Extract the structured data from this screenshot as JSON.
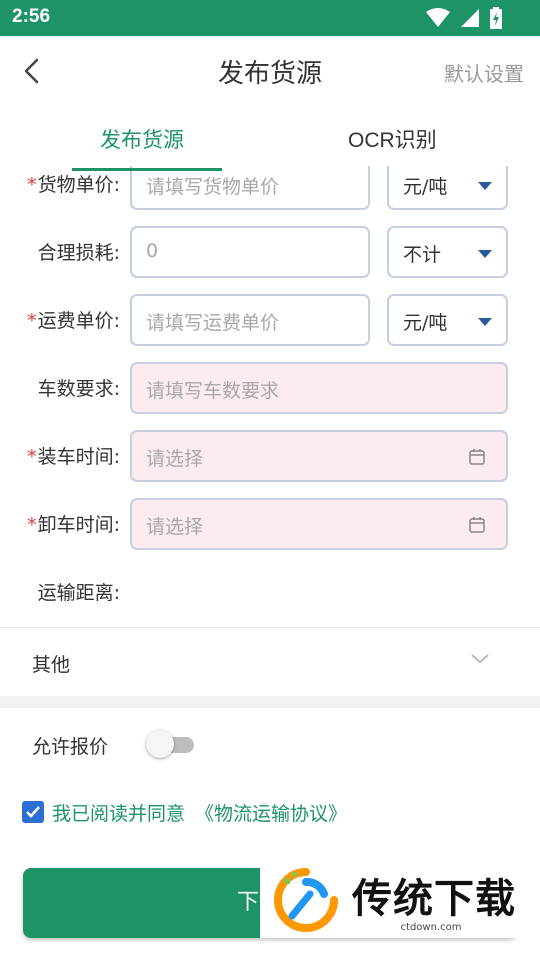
{
  "status_bar": {
    "time": "2:56"
  },
  "app_bar": {
    "title": "发布货源",
    "action": "默认设置"
  },
  "tabs": [
    {
      "label": "发布货源"
    },
    {
      "label": "OCR识别"
    }
  ],
  "form": {
    "unit_price": {
      "required_mark": "*",
      "label": "货物单价:",
      "placeholder": "请填写货物单价",
      "unit": "元/吨"
    },
    "loss": {
      "label": "合理损耗:",
      "value": "0",
      "option": "不计"
    },
    "freight": {
      "required_mark": "*",
      "label": "运费单价:",
      "placeholder": "请填写运费单价",
      "unit": "元/吨"
    },
    "trucks": {
      "label": "车数要求:",
      "placeholder": "请填写车数要求"
    },
    "load_time": {
      "required_mark": "*",
      "label": "装车时间:",
      "placeholder": "请选择"
    },
    "unload_time": {
      "required_mark": "*",
      "label": "卸车时间:",
      "placeholder": "请选择"
    },
    "distance": {
      "label": "运输距离:"
    }
  },
  "other": {
    "label": "其他"
  },
  "quote": {
    "label": "允许报价",
    "enabled": false
  },
  "agreement": {
    "text": "我已阅读并同意",
    "link": "《物流运输协议》",
    "checked": true
  },
  "submit": {
    "label": "下一步"
  },
  "watermark": {
    "brand": "传统下载",
    "url": "ctdown.com"
  },
  "colors": {
    "primary": "#1e9366",
    "required": "#e53935",
    "highlight_field": "#fdecef",
    "checkbox": "#2b6fd6"
  }
}
